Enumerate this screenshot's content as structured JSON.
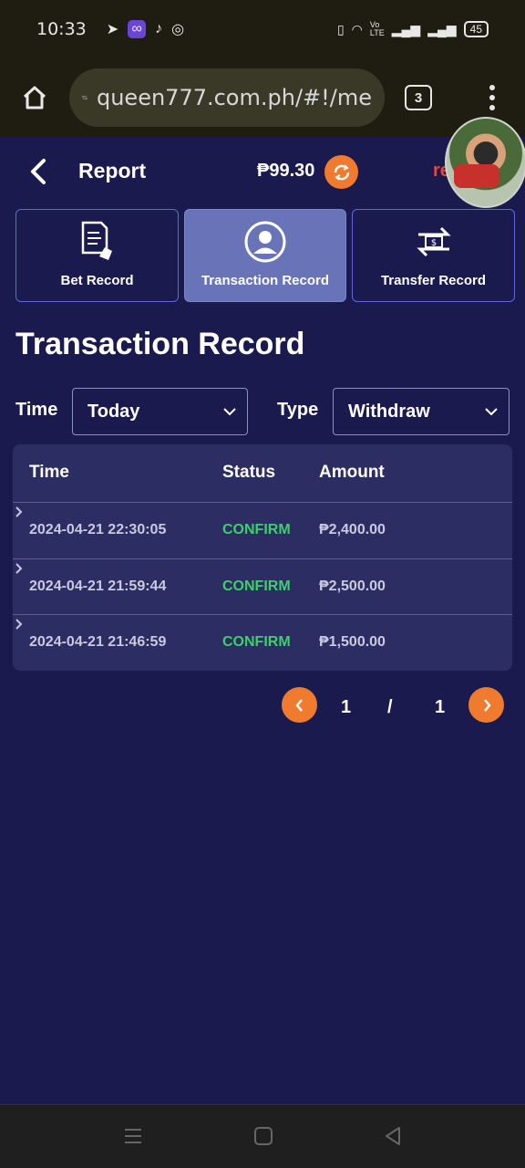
{
  "status_bar": {
    "time": "10:33",
    "battery": "45"
  },
  "browser": {
    "url": "queen777.com.ph/#!/me",
    "tab_count": "3"
  },
  "header": {
    "title": "Report",
    "balance": "₱99.30",
    "partial_text": "re"
  },
  "record_tabs": [
    {
      "label": "Bet Record",
      "active": false
    },
    {
      "label": "Transaction Record",
      "active": true
    },
    {
      "label": "Transfer Record",
      "active": false
    }
  ],
  "section_title": "Transaction Record",
  "filters": {
    "time_label": "Time",
    "time_value": "Today",
    "type_label": "Type",
    "type_value": "Withdraw"
  },
  "table": {
    "headers": {
      "time": "Time",
      "status": "Status",
      "amount": "Amount"
    },
    "rows": [
      {
        "time": "2024-04-21 22:30:05",
        "status": "CONFIRM",
        "amount": "₱2,400.00"
      },
      {
        "time": "2024-04-21 21:59:44",
        "status": "CONFIRM",
        "amount": "₱2,500.00"
      },
      {
        "time": "2024-04-21 21:46:59",
        "status": "CONFIRM",
        "amount": "₱1,500.00"
      }
    ]
  },
  "pagination": {
    "current": "1",
    "separator": "/",
    "total": "1"
  },
  "colors": {
    "background": "#1a1a4e",
    "accent": "#f07a2e",
    "confirm": "#3ecf6a",
    "tab_active": "#6974b8"
  }
}
